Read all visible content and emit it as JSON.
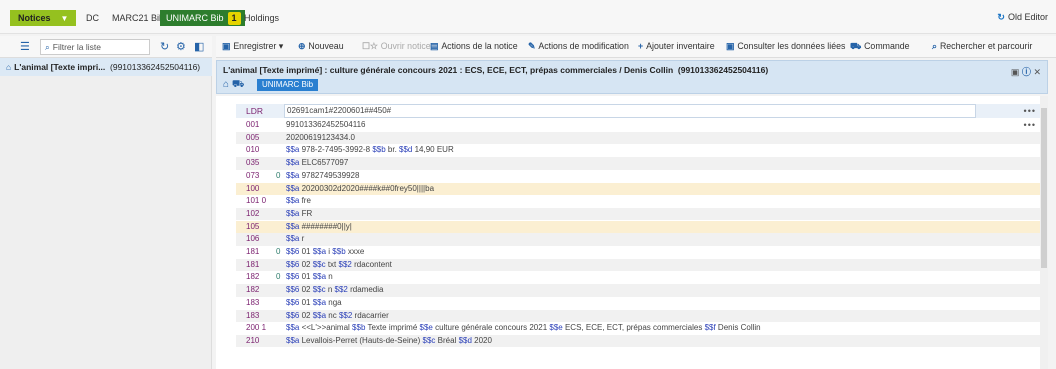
{
  "tabs": {
    "notices": "Notices",
    "dc": "DC",
    "marc21": "MARC21 Bib",
    "unimarc": "UNIMARC Bib",
    "unimarc_count": "1",
    "holdings": "Holdings",
    "old_editor": "Old Editor"
  },
  "left": {
    "filter_placeholder": "Filtrer la liste",
    "item_title": "L'animal [Texte impri...",
    "item_id": "(991013362452504116)"
  },
  "toolbar": {
    "save": "Enregistrer",
    "new": "Nouveau",
    "open": "Ouvrir notice",
    "record_actions": "Actions de la notice",
    "edit_actions": "Actions de modification",
    "add_inventory": "Ajouter inventaire",
    "linked_data": "Consulter les données liées",
    "order": "Commande",
    "search_browse": "Rechercher et parcourir"
  },
  "record": {
    "title": "L'animal [Texte imprimé] : culture générale concours 2021 : ECS, ECE, ECT, prépas commerciales / Denis Collin",
    "id": "(991013362452504116)",
    "badge": "UNIMARC Bib"
  },
  "editor": {
    "ldr_tag": "LDR",
    "ldr_value": "02691cam1#2200601##450#",
    "fields": [
      {
        "tag": "001",
        "ind": "",
        "parts": [
          {
            "t": "991013362452504116"
          }
        ]
      },
      {
        "tag": "005",
        "ind": "",
        "parts": [
          {
            "t": "20200619123434.0"
          }
        ]
      },
      {
        "tag": "010",
        "ind": "",
        "parts": [
          {
            "sf": "$$a"
          },
          {
            "t": " 978-2-7495-3992-8 "
          },
          {
            "sf": "$$b"
          },
          {
            "t": " br. "
          },
          {
            "sf": "$$d"
          },
          {
            "t": " 14,90 EUR"
          }
        ]
      },
      {
        "tag": "035",
        "ind": "",
        "parts": [
          {
            "sf": "$$a"
          },
          {
            "t": " ELC6577097"
          }
        ]
      },
      {
        "tag": "073",
        "ind": "0",
        "parts": [
          {
            "sf": "$$a"
          },
          {
            "t": " 9782749539928"
          }
        ]
      },
      {
        "tag": "100",
        "ind": "",
        "hl": true,
        "parts": [
          {
            "sf": "$$a"
          },
          {
            "t": " 20200302d2020####k##0frey50||||ba"
          }
        ]
      },
      {
        "tag": "101 0",
        "ind": "",
        "parts": [
          {
            "sf": "$$a"
          },
          {
            "t": " fre"
          }
        ]
      },
      {
        "tag": "102",
        "ind": "",
        "parts": [
          {
            "sf": "$$a"
          },
          {
            "t": " FR"
          }
        ]
      },
      {
        "tag": "105",
        "ind": "",
        "hl": true,
        "parts": [
          {
            "sf": "$$a"
          },
          {
            "t": " ########0||y|"
          }
        ]
      },
      {
        "tag": "106",
        "ind": "",
        "parts": [
          {
            "sf": "$$a"
          },
          {
            "t": " r"
          }
        ]
      },
      {
        "tag": "181",
        "ind": "0",
        "parts": [
          {
            "sf": "$$6"
          },
          {
            "t": " 01 "
          },
          {
            "sf": "$$a"
          },
          {
            "t": " i "
          },
          {
            "sf": "$$b"
          },
          {
            "t": " xxxe"
          }
        ]
      },
      {
        "tag": "181",
        "ind": "",
        "parts": [
          {
            "sf": "$$6"
          },
          {
            "t": " 02 "
          },
          {
            "sf": "$$c"
          },
          {
            "t": " txt "
          },
          {
            "sf": "$$2"
          },
          {
            "t": " rdacontent"
          }
        ]
      },
      {
        "tag": "182",
        "ind": "0",
        "parts": [
          {
            "sf": "$$6"
          },
          {
            "t": " 01 "
          },
          {
            "sf": "$$a"
          },
          {
            "t": " n"
          }
        ]
      },
      {
        "tag": "182",
        "ind": "",
        "parts": [
          {
            "sf": "$$6"
          },
          {
            "t": " 02 "
          },
          {
            "sf": "$$c"
          },
          {
            "t": " n "
          },
          {
            "sf": "$$2"
          },
          {
            "t": " rdamedia"
          }
        ]
      },
      {
        "tag": "183",
        "ind": "",
        "parts": [
          {
            "sf": "$$6"
          },
          {
            "t": " 01 "
          },
          {
            "sf": "$$a"
          },
          {
            "t": " nga"
          }
        ]
      },
      {
        "tag": "183",
        "ind": "",
        "parts": [
          {
            "sf": "$$6"
          },
          {
            "t": " 02 "
          },
          {
            "sf": "$$a"
          },
          {
            "t": " nc "
          },
          {
            "sf": "$$2"
          },
          {
            "t": " rdacarrier"
          }
        ]
      },
      {
        "tag": "200 1",
        "ind": "",
        "parts": [
          {
            "sf": "$$a"
          },
          {
            "t": " <<L'>>animal "
          },
          {
            "sf": "$$b"
          },
          {
            "t": " Texte imprimé "
          },
          {
            "sf": "$$e"
          },
          {
            "t": " culture générale concours 2021 "
          },
          {
            "sf": "$$e"
          },
          {
            "t": " ECS, ECE, ECT, prépas commerciales "
          },
          {
            "sf": "$$f"
          },
          {
            "t": " Denis Collin"
          }
        ]
      },
      {
        "tag": "210",
        "ind": "",
        "parts": [
          {
            "sf": "$$a"
          },
          {
            "t": " Levallois-Perret (Hauts-de-Seine) "
          },
          {
            "sf": "$$c"
          },
          {
            "t": " Bréal "
          },
          {
            "sf": "$$d"
          },
          {
            "t": " 2020"
          }
        ]
      }
    ]
  }
}
